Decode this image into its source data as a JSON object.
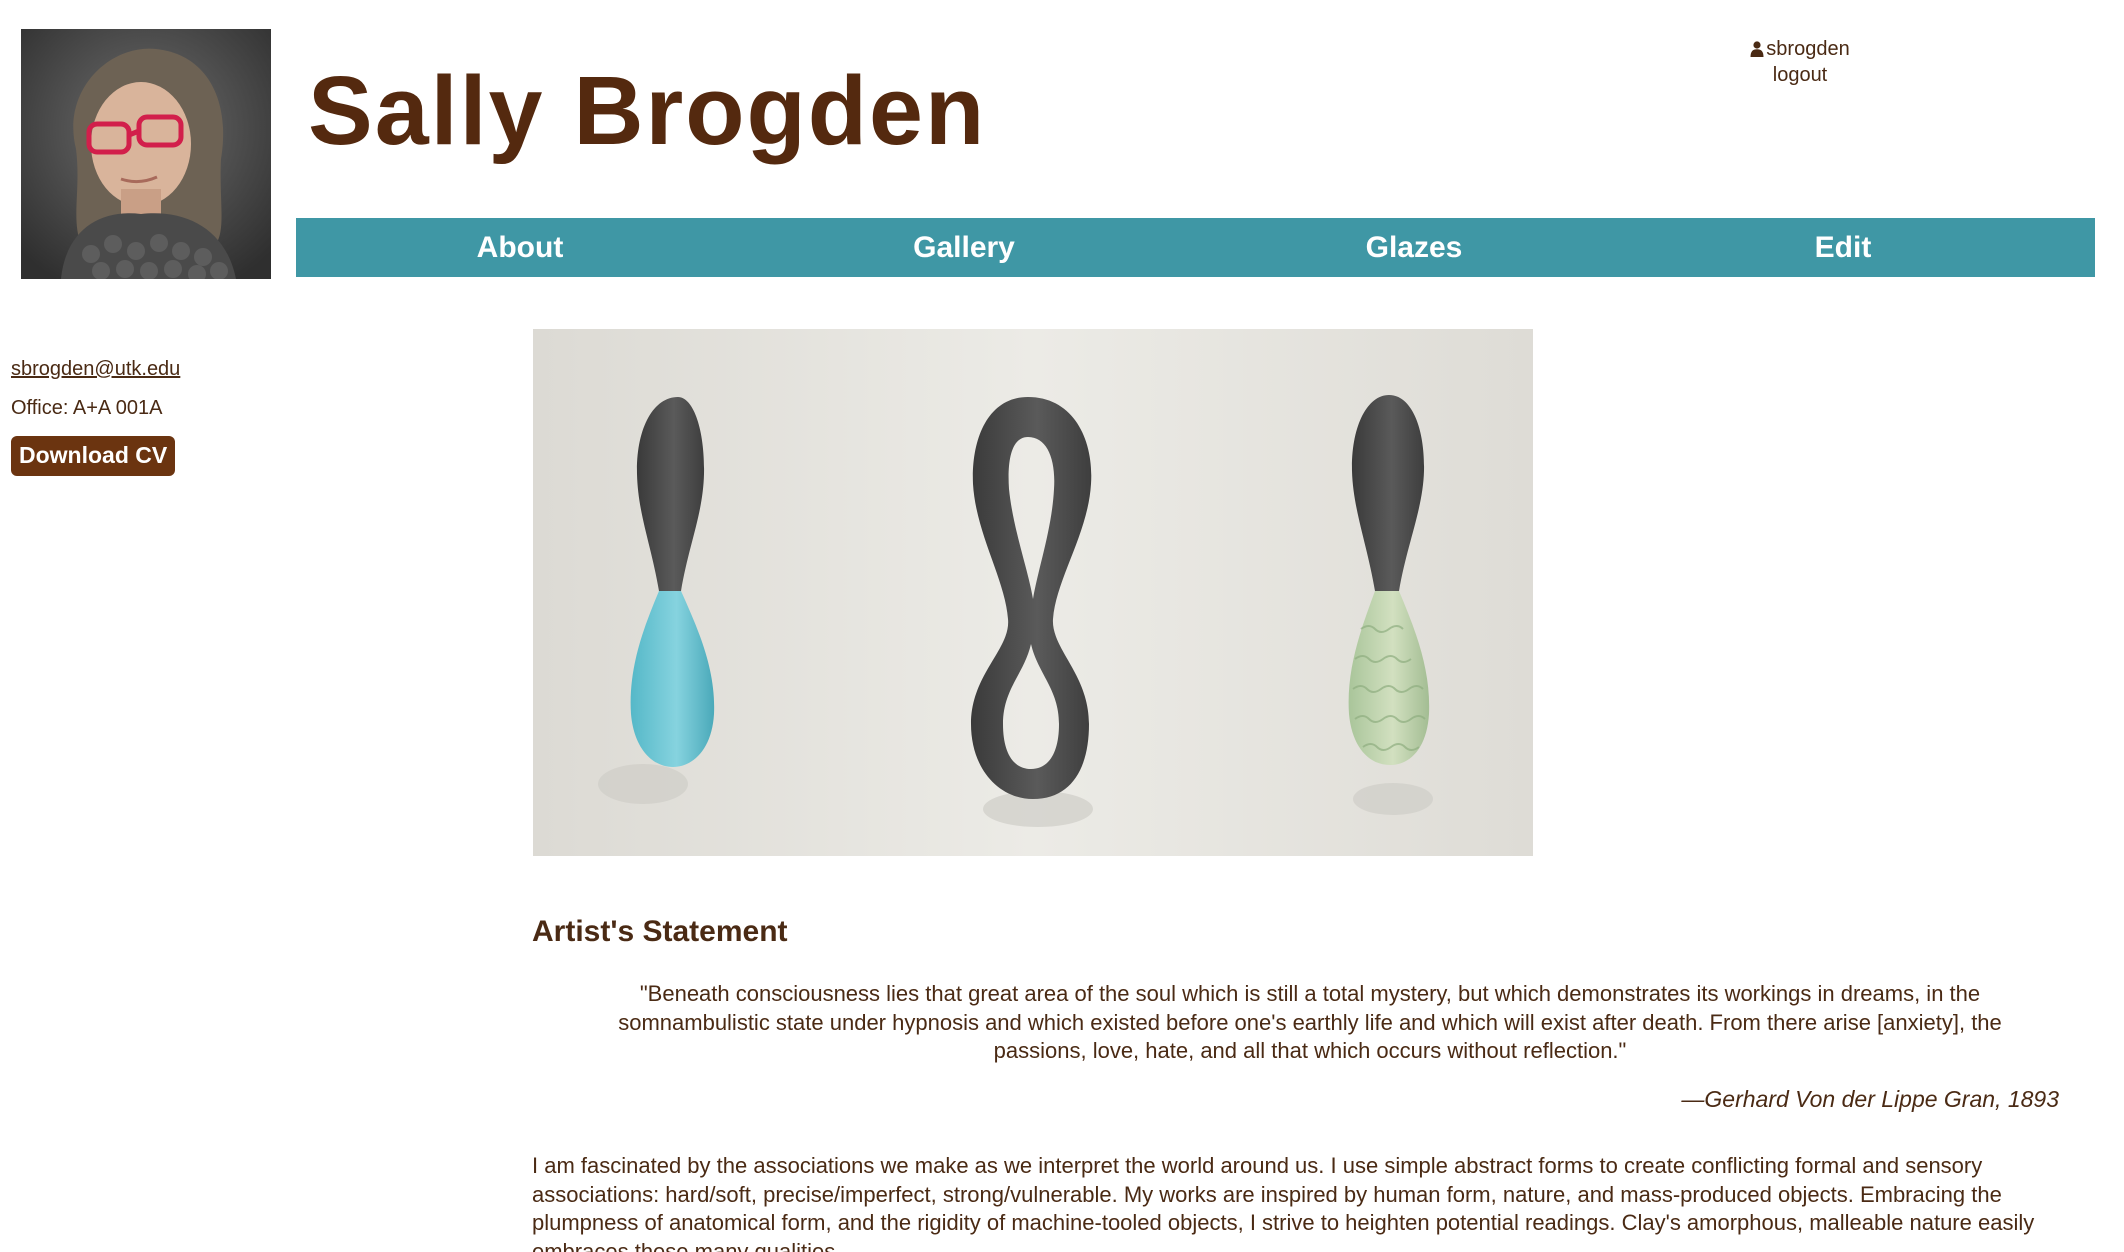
{
  "header": {
    "site_title": "Sally Brogden",
    "portrait_alt": "Portrait of Sally Brogden"
  },
  "user": {
    "username": "sbrogden",
    "logout_label": "logout"
  },
  "nav": {
    "items": [
      {
        "label": "About"
      },
      {
        "label": "Gallery"
      },
      {
        "label": "Glazes"
      },
      {
        "label": "Edit"
      }
    ]
  },
  "sidebar": {
    "email": "sbrogden@utk.edu",
    "office": "Office: A+A 001A",
    "cv_button_label": "Download CV"
  },
  "statement": {
    "heading": "Artist's Statement",
    "quote": "\"Beneath consciousness lies that great area of the soul which is still a total mystery, but which demonstrates its workings in dreams, in the somnambulistic state under hypnosis and which existed before one's earthly life and which will exist after death. From there arise [anxiety], the passions, love, hate, and all that which occurs without reflection.\"",
    "attribution": "—Gerhard Von der Lippe Gran, 1893",
    "body": "I am fascinated by the associations we make as we interpret the world around us. I use simple abstract forms to create conflicting formal and sensory associations: hard/soft, precise/imperfect, strong/vulnerable. My works are inspired by human form, nature, and mass-produced objects. Embracing the plumpness of anatomical form, and the rigidity of machine-tooled objects, I strive to heighten potential readings. Clay's amorphous, malleable nature easily embraces these many qualities."
  },
  "colors": {
    "brand_brown": "#54290f",
    "nav_teal": "#3f97a5",
    "cv_button": "#6b3410",
    "text": "#4a2a14"
  }
}
